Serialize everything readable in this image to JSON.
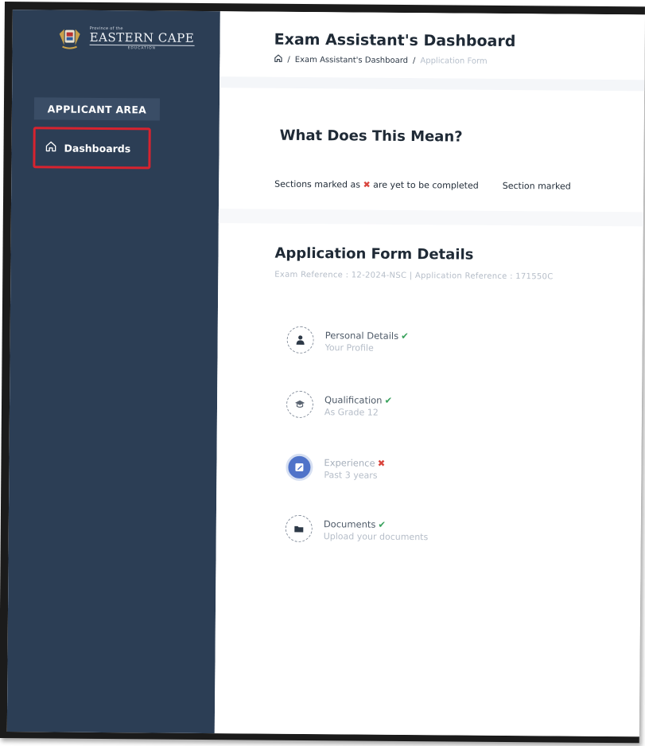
{
  "brand": {
    "small_text": "Province of the",
    "name": "EASTERN CAPE",
    "sub_text": "EDUCATION"
  },
  "sidebar": {
    "area_label": "APPLICANT AREA",
    "items": [
      {
        "label": "Dashboards",
        "icon": "home-icon"
      }
    ]
  },
  "header": {
    "title": "Exam Assistant's Dashboard",
    "breadcrumb": {
      "sep1": "/",
      "crumb1": "Exam Assistant's Dashboard",
      "sep2": "/",
      "current": "Application Form"
    }
  },
  "legend": {
    "title": "What Does This Mean?",
    "incomplete_pre": "Sections marked as",
    "incomplete_mark": "✖",
    "incomplete_post": "are yet to be completed",
    "complete_text": "Section marked"
  },
  "form": {
    "title": "Application Form Details",
    "reference": "Exam Reference : 12-2024-NSC | Application Reference : 171550C"
  },
  "steps": [
    {
      "name": "Personal Details",
      "status": "✔",
      "desc": "Your Profile",
      "icon": "user-icon"
    },
    {
      "name": "Qualification",
      "status": "✔",
      "desc": "As Grade 12",
      "icon": "graduation-cap-icon"
    },
    {
      "name": "Experience",
      "status": "✖",
      "desc": "Past 3 years",
      "icon": "edit-icon"
    },
    {
      "name": "Documents",
      "status": "✔",
      "desc": "Upload your documents",
      "icon": "folder-icon"
    }
  ],
  "colors": {
    "sidebar_bg": "#2c3e55",
    "highlight_border": "#d7232f",
    "complete": "#37a15b",
    "incomplete": "#d9453d",
    "active_step": "#4f73c9"
  }
}
